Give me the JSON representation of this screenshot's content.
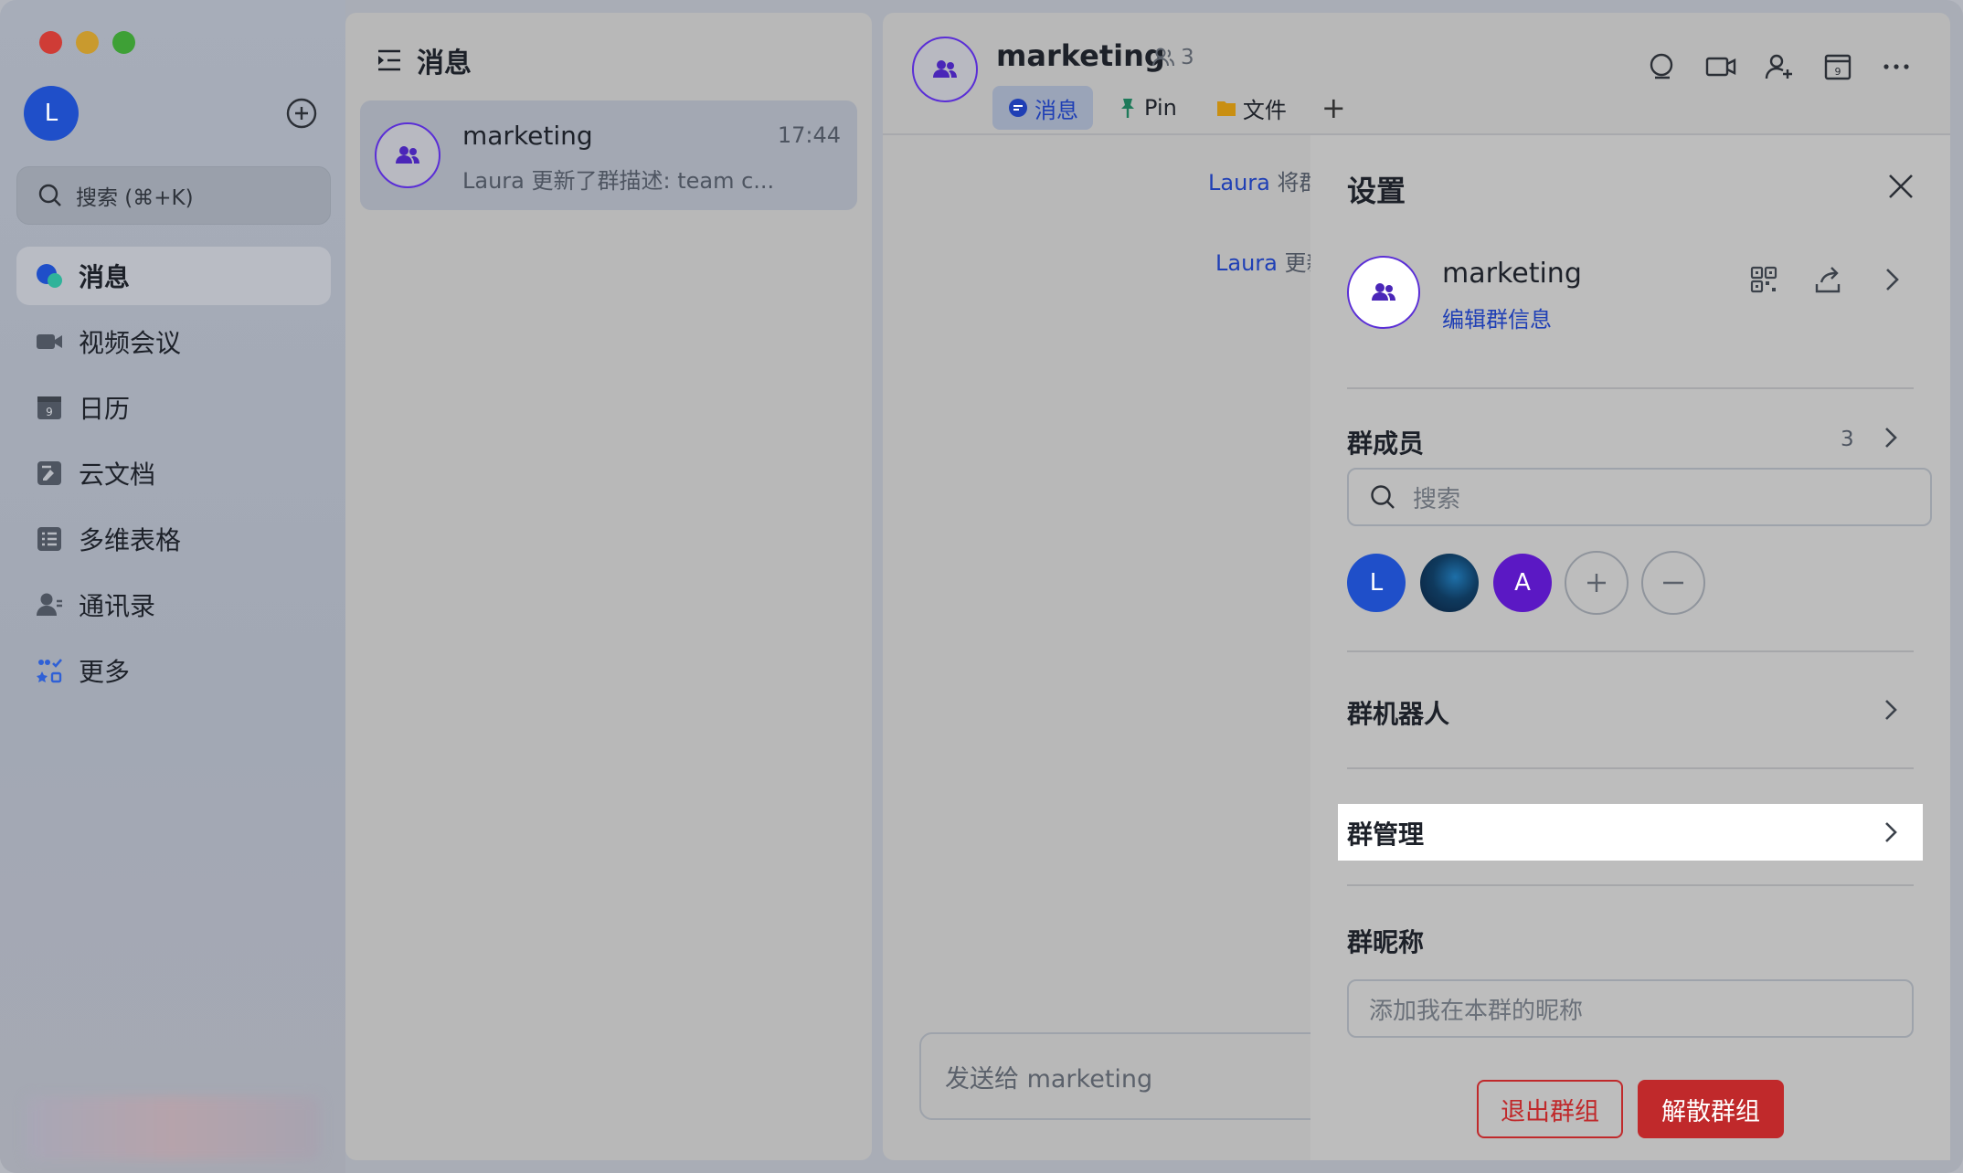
{
  "sidebar": {
    "avatar_initial": "L",
    "search_label": "搜索 (⌘+K)",
    "items": [
      {
        "label": "消息",
        "icon": "messages-icon",
        "active": true
      },
      {
        "label": "视频会议",
        "icon": "video-meeting-icon"
      },
      {
        "label": "日历",
        "icon": "calendar-icon",
        "badge": "9"
      },
      {
        "label": "云文档",
        "icon": "cloud-docs-icon"
      },
      {
        "label": "多维表格",
        "icon": "base-table-icon"
      },
      {
        "label": "通讯录",
        "icon": "contacts-icon"
      },
      {
        "label": "更多",
        "icon": "more-apps-icon"
      }
    ]
  },
  "chatlist": {
    "title": "消息",
    "items": [
      {
        "name": "marketing",
        "time": "17:44",
        "preview": "Laura 更新了群描述: team c..."
      }
    ]
  },
  "chat": {
    "title": "marketing",
    "member_count": "3",
    "tabs": [
      {
        "label": "消息",
        "icon": "message-bubble-icon",
        "active": true
      },
      {
        "label": "Pin",
        "icon": "pin-icon"
      },
      {
        "label": "文件",
        "icon": "folder-icon"
      }
    ],
    "tab_add": "+",
    "system_messages": [
      {
        "who": "Laura",
        "text": " 将群"
      },
      {
        "who": "Laura",
        "text": " 更新"
      }
    ],
    "composer_placeholder": "发送给 marketing"
  },
  "settings": {
    "title": "设置",
    "group_name": "marketing",
    "edit_link": "编辑群信息",
    "members_title": "群成员",
    "members_count": "3",
    "member_search_placeholder": "搜索",
    "members": [
      {
        "initial": "L",
        "color": "#1f4fc9"
      },
      {
        "initial": "",
        "color": "#0f3a5e"
      },
      {
        "initial": "A",
        "color": "#5b18c4"
      }
    ],
    "bots_title": "群机器人",
    "management_title": "群管理",
    "nickname_title": "群昵称",
    "nickname_placeholder": "添加我在本群的昵称",
    "leave_label": "退出群组",
    "dissolve_label": "解散群组"
  },
  "colors": {
    "accent": "#1f3fb5",
    "danger": "#c0292b",
    "group_purple": "#5a2ed6"
  }
}
